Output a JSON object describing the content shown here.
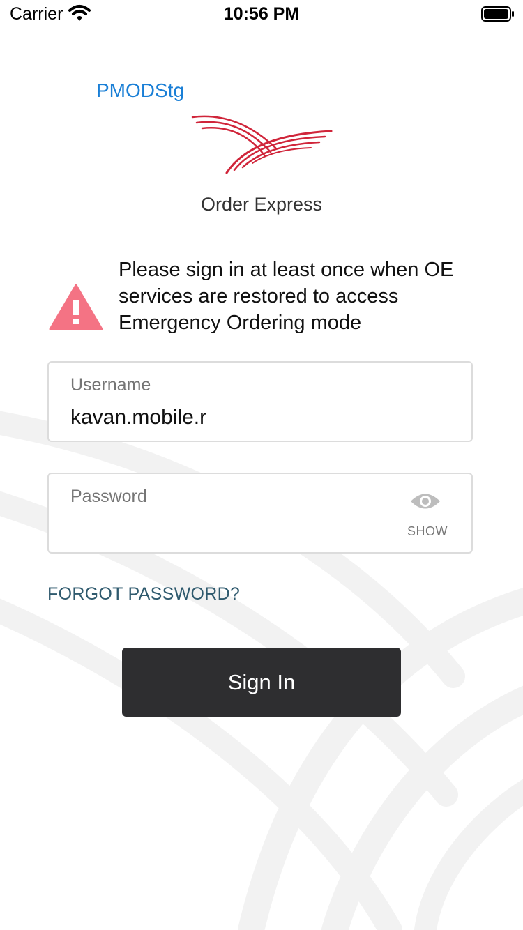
{
  "status_bar": {
    "carrier": "Carrier",
    "time": "10:56 PM",
    "wifi_icon": "wifi-icon",
    "battery_icon": "battery-icon"
  },
  "header": {
    "environment": "PMODStg",
    "app_name": "Order Express",
    "logo_icon": "cardinal-swoosh-logo"
  },
  "warning": {
    "icon": "warning-triangle-icon",
    "text": "Please sign in at least once when OE services are restored to access Emergency Ordering mode"
  },
  "form": {
    "username": {
      "label": "Username",
      "value": "kavan.mobile.r"
    },
    "password": {
      "label": "Password",
      "value": "",
      "toggle_label": "SHOW",
      "toggle_icon": "eye-icon"
    }
  },
  "links": {
    "forgot_password": "FORGOT PASSWORD?"
  },
  "actions": {
    "sign_in": "Sign In"
  },
  "colors": {
    "brand_red": "#d0253a",
    "link_blue": "#1a7fd6",
    "warning": "#f47384",
    "button_dark": "#2e2e30",
    "forgot_link": "#2f5a6e"
  }
}
